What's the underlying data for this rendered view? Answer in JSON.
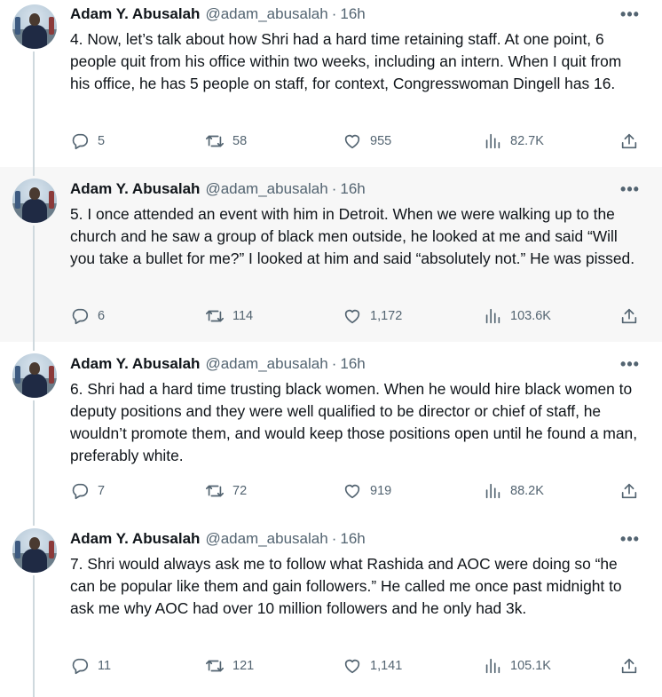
{
  "tweets": [
    {
      "author": "Adam Y. Abusalah",
      "handle": "@adam_abusalah",
      "separator": "·",
      "time": "16h",
      "text": "4. Now, let’s talk about how Shri had a hard time retaining staff. At one point, 6 people quit from his office within two weeks, including an intern. When I quit from his office, he has 5 people on staff, for context, Congresswoman Dingell has 16.",
      "replies": "5",
      "reposts": "58",
      "likes": "955",
      "views": "82.7K",
      "highlighted": false
    },
    {
      "author": "Adam Y. Abusalah",
      "handle": "@adam_abusalah",
      "separator": "·",
      "time": "16h",
      "text": "5. I once attended an event with him in Detroit. When we were walking up to the church and he saw a group of black men outside, he looked at me and said “Will you take a bullet for me?” I looked at him and said “absolutely not.” He was pissed.",
      "replies": "6",
      "reposts": "114",
      "likes": "1,172",
      "views": "103.6K",
      "highlighted": true
    },
    {
      "author": "Adam Y. Abusalah",
      "handle": "@adam_abusalah",
      "separator": "·",
      "time": "16h",
      "text": "6. Shri had a hard time trusting black women. When he would hire black women to deputy positions and they were well qualified to be director or chief of staff, he wouldn’t promote them, and would keep those positions open until he found a man, preferably white.",
      "replies": "7",
      "reposts": "72",
      "likes": "919",
      "views": "88.2K",
      "highlighted": false
    },
    {
      "author": "Adam Y. Abusalah",
      "handle": "@adam_abusalah",
      "separator": "·",
      "time": "16h",
      "text": "7. Shri would always ask me to follow what Rashida and AOC were doing so “he can be popular like them and gain followers.” He called me once past midnight to ask me why AOC had over 10 million followers and he only had 3k.",
      "replies": "11",
      "reposts": "121",
      "likes": "1,141",
      "views": "105.1K",
      "highlighted": false
    }
  ],
  "icons": {
    "more": "more-horizontal-icon",
    "reply": "reply-icon",
    "repost": "repost-icon",
    "like": "heart-icon",
    "views": "analytics-icon",
    "share": "share-icon"
  },
  "colors": {
    "text": "#0f1419",
    "secondary": "#536471",
    "thread_line": "#cfd9de",
    "highlight_bg": "#f7f7f7"
  }
}
